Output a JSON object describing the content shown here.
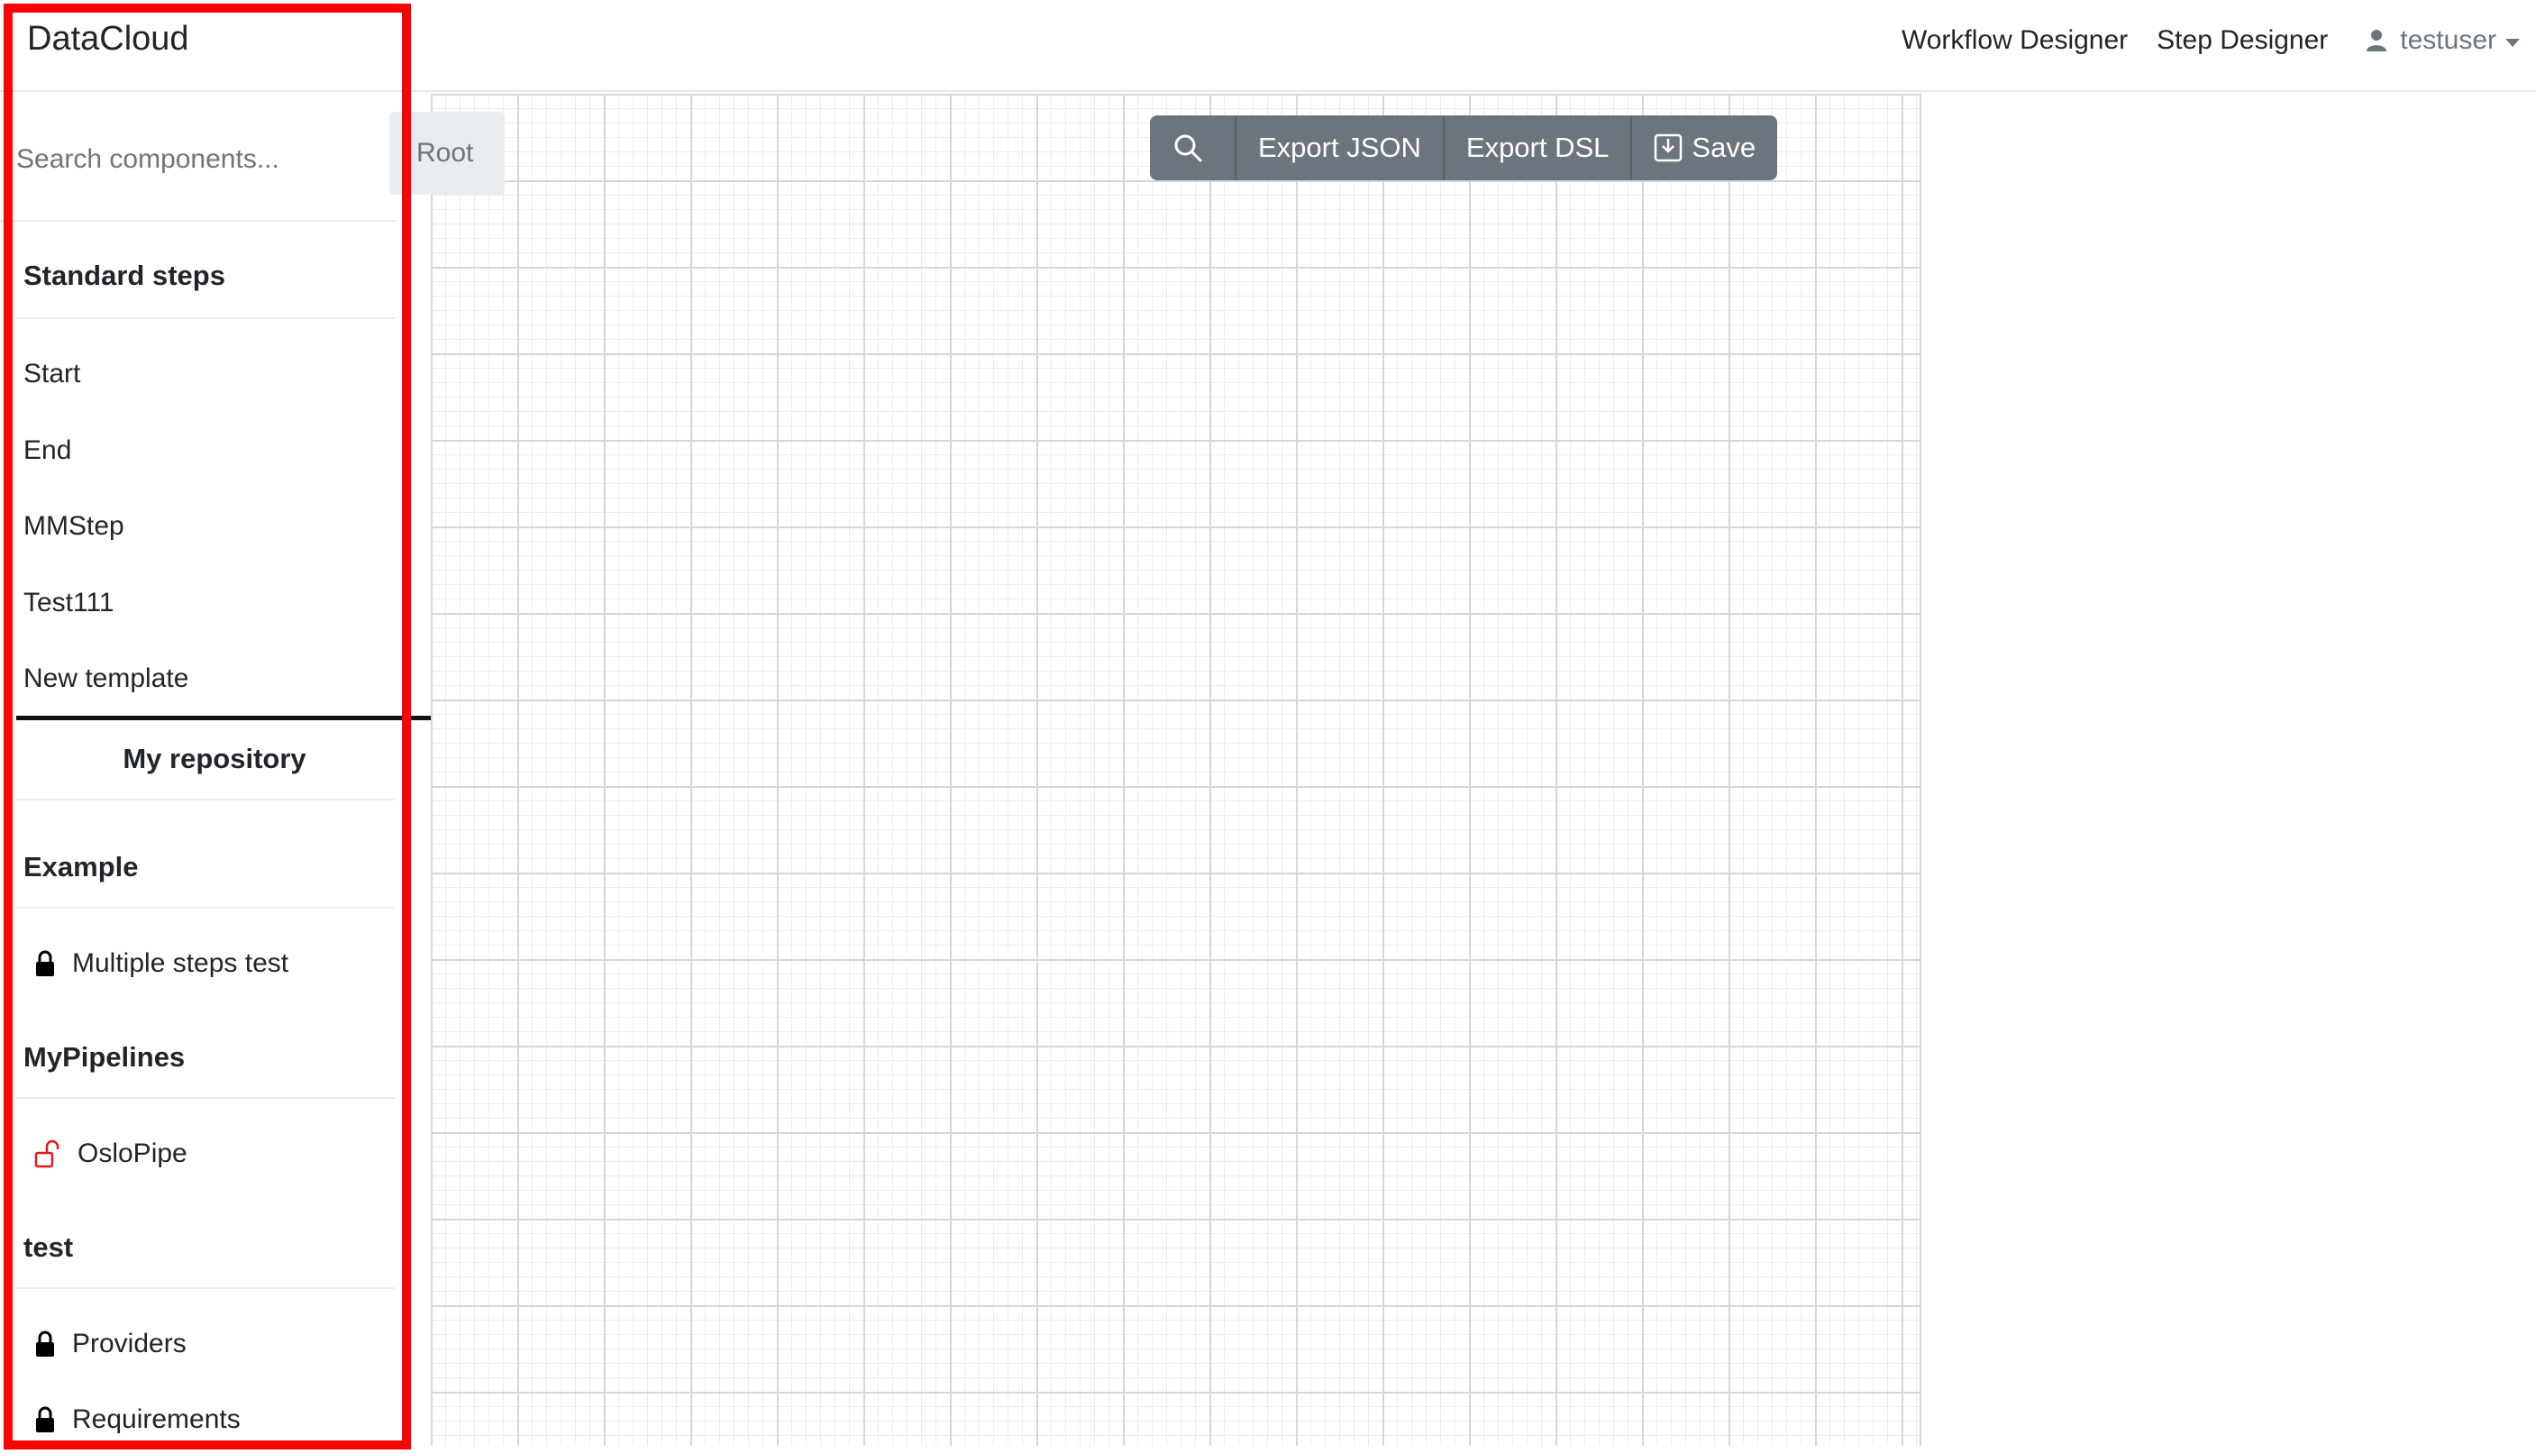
{
  "navbar": {
    "brand": "DataCloud",
    "links": [
      "Workflow Designer",
      "Step Designer"
    ],
    "user": "testuser"
  },
  "sidebar": {
    "search_placeholder": "Search components...",
    "standard_steps_title": "Standard steps",
    "standard_steps": [
      "Start",
      "End",
      "MMStep",
      "Test111",
      "New template"
    ],
    "repository_title": "My repository",
    "groups": [
      {
        "title": "Example",
        "items": [
          {
            "label": "Multiple steps test",
            "icon": "lock-icon"
          }
        ]
      },
      {
        "title": "MyPipelines",
        "items": [
          {
            "label": "OsloPipe",
            "icon": "unlock-icon"
          }
        ]
      },
      {
        "title": "test",
        "items": [
          {
            "label": "Providers",
            "icon": "lock-icon"
          },
          {
            "label": "Requirements",
            "icon": "lock-icon"
          }
        ]
      }
    ]
  },
  "breadcrumb": {
    "root": "Root"
  },
  "toolbar": {
    "search_icon": "search-icon",
    "export_json": "Export JSON",
    "export_dsl": "Export DSL",
    "save": "Save",
    "save_icon": "save-icon"
  },
  "colors": {
    "highlight": "#ff0000",
    "toolbar_bg": "#6c757d",
    "unlock_icon": "#e0181b"
  }
}
